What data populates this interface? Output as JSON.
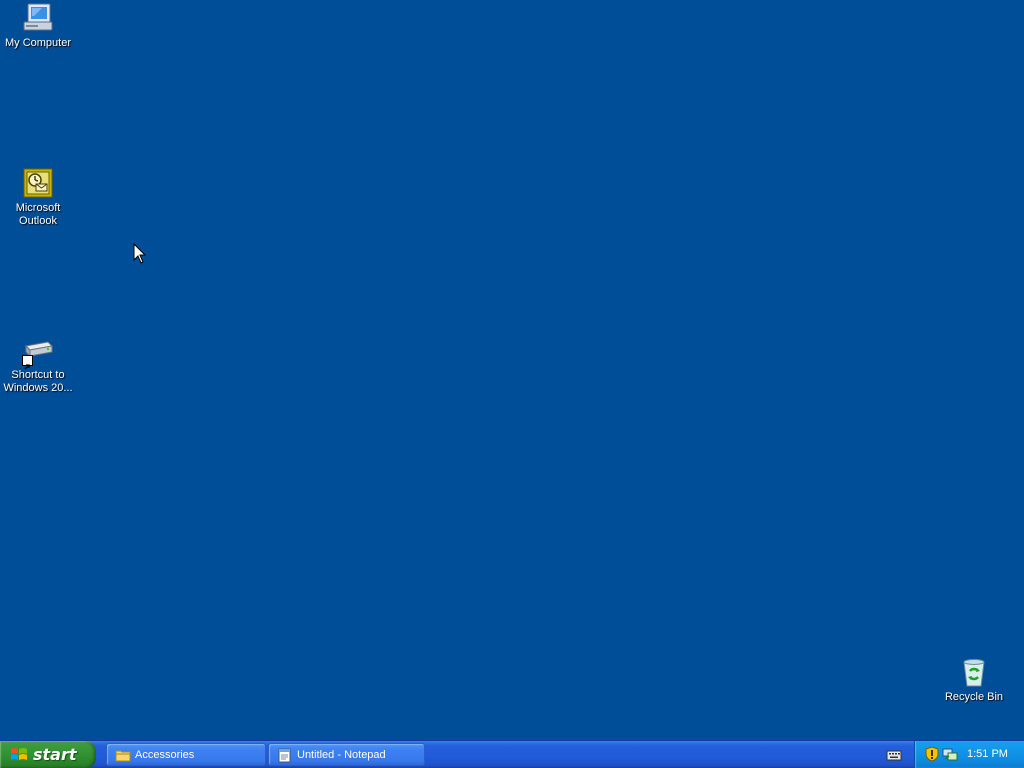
{
  "desktop": {
    "background": "#004e98",
    "icons": [
      {
        "label": "My Computer",
        "icon": "my-computer-icon"
      },
      {
        "label": "Microsoft Outlook",
        "icon": "outlook-icon"
      },
      {
        "label": "Shortcut to Windows 20...",
        "icon": "drive-shortcut-icon"
      },
      {
        "label": "Recycle Bin",
        "icon": "recycle-bin-icon"
      }
    ]
  },
  "taskbar": {
    "start_label": "start",
    "tasks": [
      {
        "label": "Accessories",
        "icon": "folder-icon"
      },
      {
        "label": "Untitled - Notepad",
        "icon": "notepad-icon"
      }
    ],
    "tray": {
      "icons": [
        "keyboard-icon",
        "security-shield-icon",
        "network-icon"
      ],
      "clock": "1:51 PM"
    }
  },
  "colors": {
    "start_green": "#3c9a3c",
    "taskbar_blue": "#245edb",
    "tray_blue": "#0e8be0"
  }
}
